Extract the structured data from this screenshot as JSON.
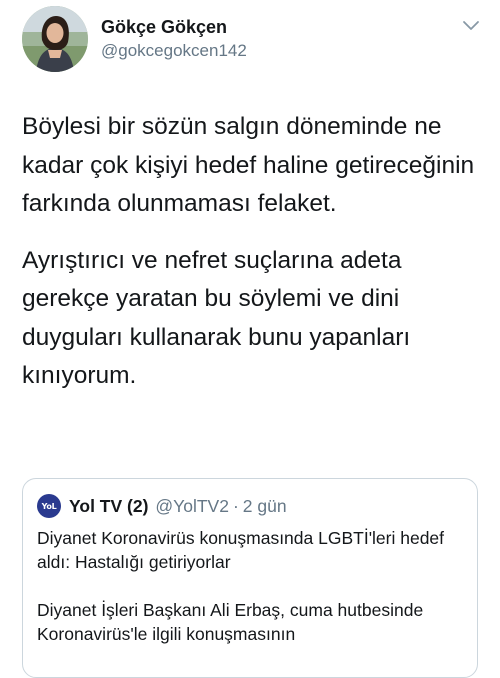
{
  "user": {
    "display_name": "Gökçe Gökçen",
    "handle": "@gokcegokcen142",
    "avatar_icon": "user-avatar-photo"
  },
  "tweet": {
    "paragraphs": [
      "Böylesi bir sözün salgın döneminde ne kadar çok kişiyi hedef haline getireceğinin farkında olunmaması felaket.",
      "Ayrıştırıcı ve nefret suçlarına adeta gerekçe yaratan bu söylemi ve dini duyguları kullanarak bunu yapanları kınıyorum."
    ]
  },
  "quoted_tweet": {
    "logo_text": "YoL",
    "display_name": "Yol TV (2)",
    "handle": "@YolTV2",
    "separator": "·",
    "time": "2 gün",
    "paragraphs": [
      "Diyanet Koronavirüs konuşmasında LGBTİ'leri hedef aldı: Hastalığı getiriyorlar",
      "Diyanet İşleri Başkanı Ali Erbaş, cuma hutbesinde Koronavirüs'le ilgili konuşmasının"
    ]
  },
  "colors": {
    "primary_text": "#14171a",
    "secondary_text": "#657786",
    "border": "#ccd6dd",
    "logo_bg": "#2a3a8f"
  }
}
